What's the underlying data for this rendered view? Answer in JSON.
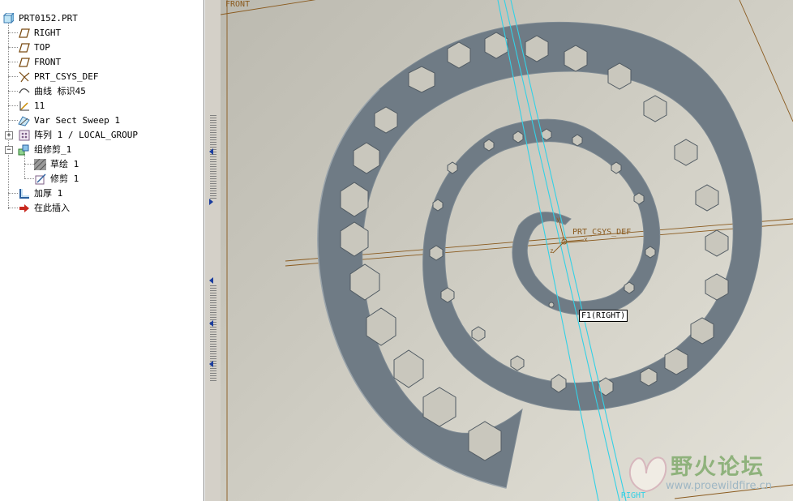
{
  "model_tree": {
    "items": [
      {
        "label": "PRT0152.PRT",
        "icon": "part-icon"
      },
      {
        "label": "RIGHT",
        "icon": "datum-plane-icon"
      },
      {
        "label": "TOP",
        "icon": "datum-plane-icon"
      },
      {
        "label": "FRONT",
        "icon": "datum-plane-icon"
      },
      {
        "label": "PRT_CSYS_DEF",
        "icon": "csys-icon"
      },
      {
        "label": "曲线 标识45",
        "icon": "curve-icon"
      },
      {
        "label": "11",
        "icon": "datum-graph-icon"
      },
      {
        "label": "Var Sect Sweep 1",
        "icon": "sweep-icon"
      },
      {
        "label": "阵列 1 / LOCAL_GROUP",
        "icon": "pattern-icon"
      },
      {
        "label": "组修剪_1",
        "icon": "group-icon"
      },
      {
        "label": "草绘 1",
        "icon": "sketch-icon"
      },
      {
        "label": "修剪 1",
        "icon": "trim-icon"
      },
      {
        "label": "加厚 1",
        "icon": "thicken-icon"
      },
      {
        "label": "在此插入",
        "icon": "insert-here-icon"
      }
    ]
  },
  "viewport": {
    "front_label": "FRONT",
    "csys_label": "PRT_CSYS_DEF",
    "right_tag": "F1(RIGHT)",
    "right_bottom_label": "RIGHT",
    "axis_x": "x",
    "axis_y": "y",
    "axis_z": "z"
  },
  "watermark": {
    "title": "野火论坛",
    "url": "www.proewildfire.cn"
  },
  "colors": {
    "part": "#6f7b85",
    "datum_plane": "#8a5a1e",
    "datum_axis": "#33d1e6",
    "background": "#c9c7bd"
  }
}
